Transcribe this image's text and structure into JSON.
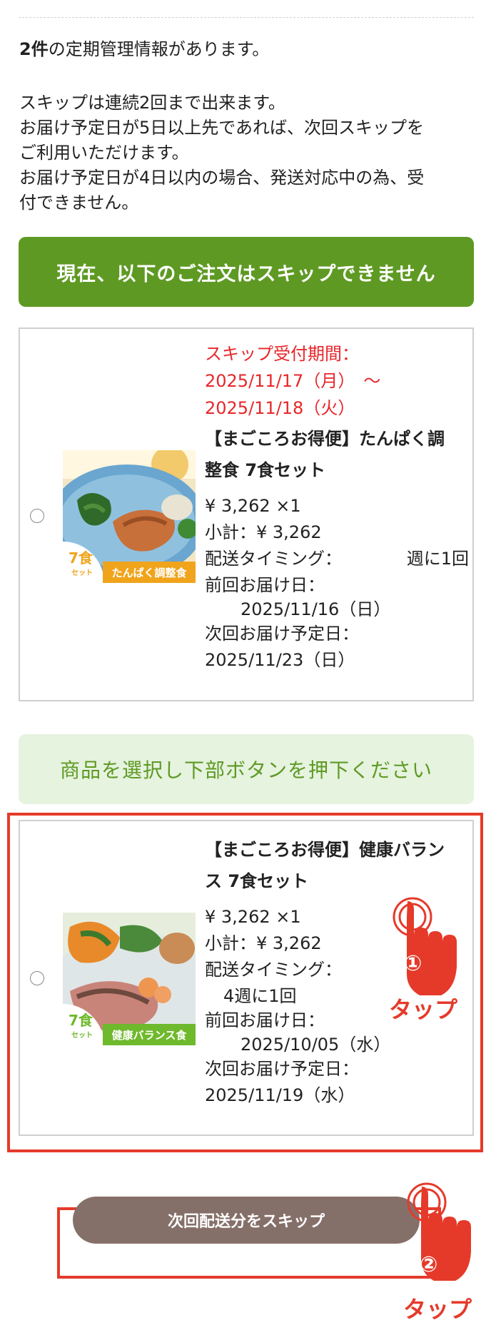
{
  "summary": {
    "count_bold": "2件",
    "count_rest": "の定期管理情報があります。"
  },
  "notes": [
    "スキップは連続2回まで出来ます。",
    "お届け予定日が5日以上先であれば、次回スキップを",
    "ご利用いただけます。",
    "お届け予定日が4日以内の場合、発送対応中の為、受",
    "付できません。"
  ],
  "banner_cannot_skip": "現在、以下のご注文はスキップできません",
  "banner_select": "商品を選択し下部ボタンを押下ください",
  "items": [
    {
      "skip_period_label": "スキップ受付期間：",
      "skip_period_start": "2025/11/17（月）　～",
      "skip_period_end": "2025/11/18（火）",
      "title_line1": "【まごころお得便】たんぱく調",
      "title_line2": "整食 7食セット",
      "price": "¥ 3,262 ×1",
      "subtotal": "小計：¥ 3,262",
      "timing_label": "配送タイミング：",
      "timing_value": "週に1回",
      "last_label": "前回お届け日：",
      "last_date": "2025/11/16（日）",
      "next_label": "次回お届け予定日：",
      "next_date": "2025/11/23（日）",
      "badge_num": "7食",
      "badge_set": "セット",
      "label": "たんぱく調整食",
      "label_color": "#f0a41c"
    },
    {
      "title_line1": "【まごころお得便】健康バラン",
      "title_line2": "ス 7食セット",
      "price": "¥ 3,262 ×1",
      "subtotal": "小計：¥ 3,262",
      "timing_label": "配送タイミング：",
      "timing_value": "4週に1回",
      "last_label": "前回お届け日：",
      "last_date": "2025/10/05（水）",
      "next_label": "次回お届け予定日：",
      "next_date": "2025/11/19（水）",
      "badge_num": "7食",
      "badge_set": "セット",
      "label": "健康バランス食",
      "label_color": "#6fb92c"
    }
  ],
  "skip_button": "次回配送分をスキップ",
  "annotations": {
    "step1": "①",
    "step2": "②",
    "tap": "タップ",
    "accent_color": "#e53a2a"
  }
}
